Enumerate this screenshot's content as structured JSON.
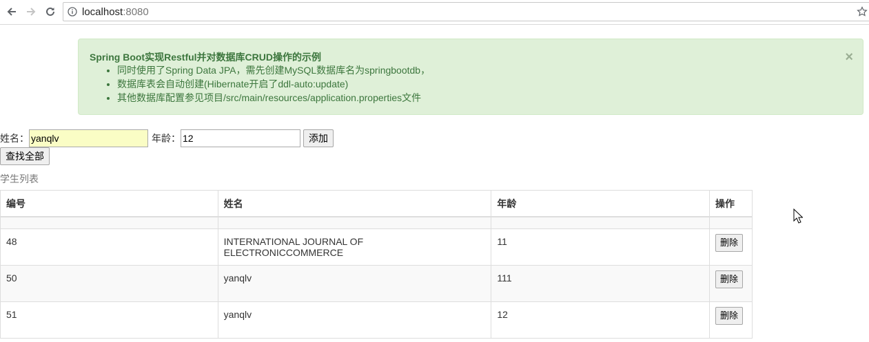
{
  "browser": {
    "url_host": "localhost",
    "url_port": ":8080"
  },
  "alert": {
    "title": "Spring Boot实现Restful并对数据库CRUD操作的示例",
    "items": [
      "同时使用了Spring Data JPA，需先创建MySQL数据库名为springbootdb，",
      "数据库表会自动创建(Hibernate开启了ddl-auto:update)",
      "其他数据库配置参见项目/src/main/resources/application.properties文件"
    ],
    "close": "×"
  },
  "form": {
    "name_label": "姓名：",
    "name_value": "yanqlv",
    "age_label": "年龄：",
    "age_value": "12",
    "add_label": "添加",
    "find_all_label": "查找全部"
  },
  "list_title": "学生列表",
  "table": {
    "headers": [
      "编号",
      "姓名",
      "年龄",
      "操作"
    ],
    "rows": [
      {
        "id": "48",
        "name": "INTERNATIONAL JOURNAL OF ELECTRONICCOMMERCE",
        "age": "11",
        "action": "删除"
      },
      {
        "id": "50",
        "name": "yanqlv",
        "age": "111",
        "action": "删除"
      },
      {
        "id": "51",
        "name": "yanqlv",
        "age": "12",
        "action": "删除"
      }
    ]
  },
  "icons": {
    "back": "back-arrow-icon",
    "forward": "forward-arrow-icon",
    "reload": "reload-icon",
    "info": "info-icon",
    "star": "star-icon",
    "cursor": "mouse-cursor-icon"
  }
}
